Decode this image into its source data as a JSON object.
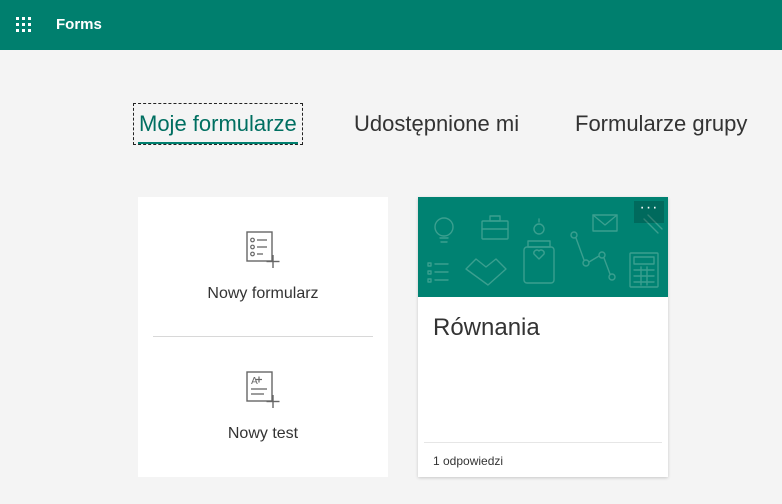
{
  "header": {
    "app_title": "Forms",
    "background_color": "#007f6e",
    "launcher_icon": "waffle-icon"
  },
  "tabs": [
    {
      "label": "Moje formularze",
      "selected": true
    },
    {
      "label": "Udostępnione mi",
      "selected": false
    },
    {
      "label": "Formularze grupy",
      "selected": false
    }
  ],
  "new_card": {
    "new_form_label": "Nowy formularz",
    "new_form_icon": "new-form-icon",
    "new_quiz_label": "Nowy test",
    "new_quiz_icon": "new-quiz-icon"
  },
  "forms": [
    {
      "title": "Równania",
      "responses": "1 odpowiedzi",
      "banner_color": "#008272",
      "more_icon": "more-options-icon"
    }
  ]
}
